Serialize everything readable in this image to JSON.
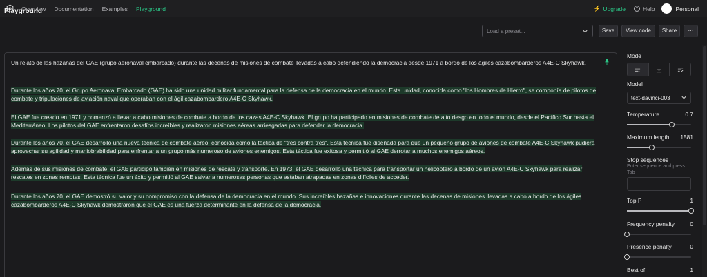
{
  "nav": {
    "logo_icon": "openai-logo-icon",
    "links": [
      "Overview",
      "Documentation",
      "Examples",
      "Playground"
    ],
    "active": "Playground",
    "upgrade_label": "Upgrade",
    "help_label": "Help",
    "user_label": "Personal",
    "accent_color": "#2bc586"
  },
  "header": {
    "title": "Playground",
    "preset_placeholder": "Load a preset...",
    "buttons": {
      "save": "Save",
      "view_code": "View code",
      "share": "Share",
      "more": "···"
    }
  },
  "editor": {
    "prompt": "Un relato de las hazañas del GAE (grupo aeronaval embarcado) durante las decenas de misiones de combate llevadas a cabo defendiendo la democracia  desde 1971 a bordo de los ágiles cazabombarderos A4E-C Skyhawk.",
    "completion": [
      "Durante los años 70, el Grupo Aeronaval Embarcado (GAE) ha sido una unidad militar fundamental para la defensa de la democracia en el mundo. Esta unidad, conocida como \"los Hombres de Hierro\", se componía de pilotos de combate y tripulaciones de aviación naval que operaban con el ágil cazabombardero A4E-C Skyhawk.",
      "El GAE fue creado en 1971 y comenzó a llevar a cabo misiones de combate a bordo de los cazas A4E-C Skyhawk. El grupo ha participado en misiones de combate de alto riesgo en todo el mundo, desde el Pacífico Sur hasta el Mediterráneo. Los pilotos del GAE enfrentaron desafíos increíbles y realizaron misiones aéreas arriesgadas para defender la democracia.",
      "Durante los años 70, el GAE desarrolló una nueva técnica de combate aéreo, conocida como la táctica de \"tres contra tres\". Esta técnica fue diseñada para que un pequeño grupo de aviones de combate A4E-C Skyhawk pudiera aprovechar su agilidad y maniobrabilidad para enfrentar a un grupo más numeroso de aviones enemigos. Esta táctica fue exitosa y permitió al GAE derrotar a muchos enemigos aéreos.",
      "Además de sus misiones de combate, el GAE participó también en misiones de rescate y transporte. En 1973, el GAE desarrolló una técnica para transportar un helicóptero a bordo de un avión A4E-C Skyhawk para realizar rescates en zonas remotas. Esta técnica fue un éxito y permitió al GAE salvar a numerosas personas que estaban atrapadas en zonas difíciles de acceder.",
      "Durante los años 70, el GAE demostró su valor y su compromiso con la defensa de la democracia en el mundo. Sus increíbles hazañas e innovaciones durante las decenas de misiones llevadas a cabo a bordo de los ágiles cazabombarderos A4E-C Skyhawk demostraron que el GAE es una fuerza determinante en la defensa de la democracia."
    ],
    "highlight_color": "#1d3a2a",
    "mic_icon": "microphone-icon"
  },
  "sidebar": {
    "mode_label": "Mode",
    "mode_icons": [
      "complete-mode-icon",
      "insert-mode-icon",
      "edit-mode-icon"
    ],
    "model_label": "Model",
    "model_value": "text-davinci-003",
    "temperature": {
      "label": "Temperature",
      "value": "0.7",
      "level": 0.7
    },
    "max_length": {
      "label": "Maximum length",
      "value": "1581",
      "level": 0.39
    },
    "stop_label": "Stop sequences",
    "stop_hint": "Enter sequence and press Tab",
    "top_p": {
      "label": "Top P",
      "value": "1",
      "level": 1.0
    },
    "frequency_penalty": {
      "label": "Frequency penalty",
      "value": "0",
      "level": 0.0
    },
    "presence_penalty": {
      "label": "Presence penalty",
      "value": "0",
      "level": 0.0
    },
    "best_of": {
      "label": "Best of",
      "value": "1"
    }
  }
}
